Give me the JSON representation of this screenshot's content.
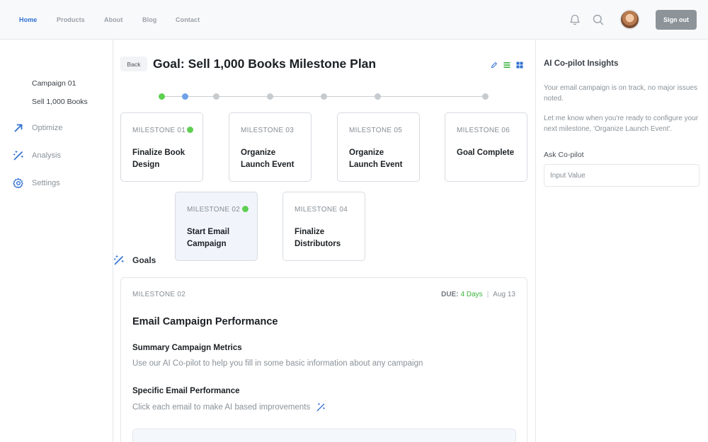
{
  "nav": {
    "links": [
      "Home",
      "Products",
      "About",
      "Blog",
      "Contact"
    ],
    "active": "Home",
    "icons": [
      "bell-icon",
      "search-icon"
    ],
    "sign_out": "Sign out"
  },
  "sidebar": {
    "goals": "Goals",
    "sub_items": [
      "Campaign 01",
      "Sell 1,000 Books"
    ],
    "optimize": "Optimize",
    "analysis": "Analysis",
    "settings": "Settings"
  },
  "main": {
    "back": "Back",
    "title": "Goal: Sell 1,000 Books Milestone Plan",
    "view_icons": [
      "pencil-icon",
      "list-icon",
      "grid-icon"
    ],
    "progress_dots": [
      "complete",
      "current",
      "pending",
      "pending",
      "pending",
      "pending",
      "pending"
    ],
    "milestones": [
      {
        "num": "MILESTONE 01",
        "name": "Finalize Book Design",
        "done": true
      },
      {
        "num": "MILESTONE 03",
        "name": "Organize Launch Event",
        "done": false
      },
      {
        "num": "MILESTONE 05",
        "name": "Organize Launch Event",
        "done": false
      },
      {
        "num": "MILESTONE 06",
        "name": "Goal Complete",
        "done": false
      },
      {
        "num": "MILESTONE 02",
        "name": "Start Email Campaign",
        "done": true
      },
      {
        "num": "MILESTONE 04",
        "name": "Finalize Distributors",
        "done": false
      }
    ],
    "detail": {
      "num": "MILESTONE 02",
      "due_label": "DUE:",
      "due_value": "4 Days",
      "due_date": "Aug 13",
      "title": "Email Campaign Performance",
      "section1_title": "Summary Campaign Metrics",
      "section1_desc": "Use our AI Co-pilot to help you fill in some basic information about any campaign",
      "section2_title": "Specific Email Performance",
      "section2_desc": "Click each email to make AI based improvements"
    }
  },
  "copilot": {
    "title": "AI Co-pilot Insights",
    "text1": "Your email campaign is on track, no major issues noted.",
    "text2": "Let me know when you're ready to configure your next milestone, 'Organize Launch Event'.",
    "ask_label": "Ask Co-pilot",
    "input_placeholder": "Input Value"
  },
  "colors": {
    "accent": "#2f6fd1",
    "success": "#5fcf52",
    "muted": "#8a9299"
  }
}
